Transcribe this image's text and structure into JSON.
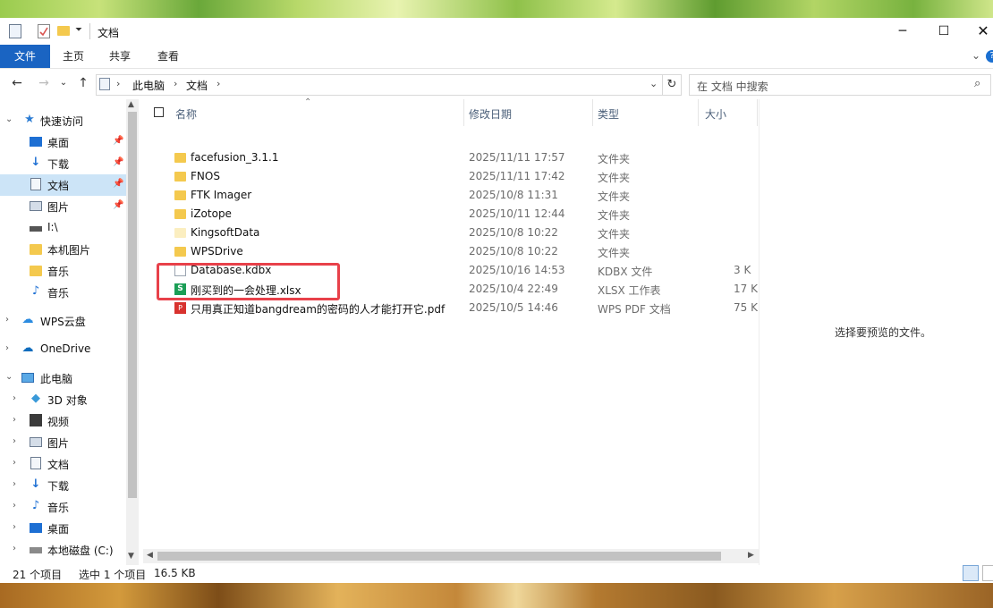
{
  "window": {
    "title": "文档"
  },
  "ribbon": {
    "tabs": [
      "文件",
      "主页",
      "共享",
      "查看"
    ]
  },
  "address": {
    "segments": [
      "此电脑",
      "文档"
    ]
  },
  "search": {
    "placeholder": "在 文档 中搜索"
  },
  "nav": {
    "items": [
      {
        "label": "快速访问"
      },
      {
        "label": "桌面"
      },
      {
        "label": "下载"
      },
      {
        "label": "文档"
      },
      {
        "label": "图片"
      },
      {
        "label": "I:\\"
      },
      {
        "label": "本机图片"
      },
      {
        "label": "音乐"
      },
      {
        "label": "音乐"
      },
      {
        "label": "WPS云盘"
      },
      {
        "label": "OneDrive"
      },
      {
        "label": "此电脑"
      },
      {
        "label": "3D 对象"
      },
      {
        "label": "视频"
      },
      {
        "label": "图片"
      },
      {
        "label": "文档"
      },
      {
        "label": "下载"
      },
      {
        "label": "音乐"
      },
      {
        "label": "桌面"
      },
      {
        "label": "本地磁盘 (C:)"
      }
    ]
  },
  "columns": {
    "name": "名称",
    "date": "修改日期",
    "type": "类型",
    "size": "大小"
  },
  "files": [
    {
      "name": "facefusion_3.1.1",
      "date": "2025/11/11 17:57",
      "type": "文件夹",
      "size": ""
    },
    {
      "name": "FNOS",
      "date": "2025/11/11 17:42",
      "type": "文件夹",
      "size": ""
    },
    {
      "name": "FTK Imager",
      "date": "2025/10/8 11:31",
      "type": "文件夹",
      "size": ""
    },
    {
      "name": "iZotope",
      "date": "2025/10/11 12:44",
      "type": "文件夹",
      "size": ""
    },
    {
      "name": "KingsoftData",
      "date": "2025/10/8 10:22",
      "type": "文件夹",
      "size": ""
    },
    {
      "name": "WPSDrive",
      "date": "2025/10/8 10:22",
      "type": "文件夹",
      "size": ""
    },
    {
      "name": "Database.kdbx",
      "date": "2025/10/16 14:53",
      "type": "KDBX 文件",
      "size": "3 K"
    },
    {
      "name": "刚买到的一会处理.xlsx",
      "date": "2025/10/4 22:49",
      "type": "XLSX 工作表",
      "size": "17 K"
    },
    {
      "name": "只用真正知道bangdream的密码的人才能打开它.pdf",
      "date": "2025/10/5 14:46",
      "type": "WPS PDF 文档",
      "size": "75 K"
    }
  ],
  "preview": {
    "text": "选择要预览的文件。"
  },
  "status": {
    "count": "21 个项目",
    "selected": "选中 1 个项目",
    "size": "16.5 KB"
  }
}
